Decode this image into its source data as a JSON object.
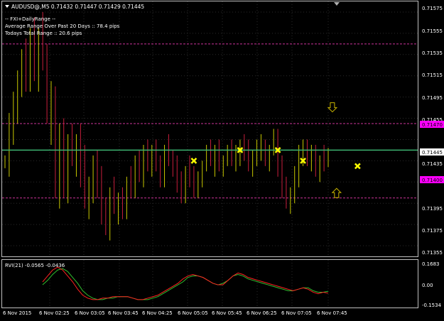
{
  "colors": {
    "background": "#000000",
    "frame": "#c0c0c0",
    "text": "#ffffff",
    "grid": "#2a2a2a",
    "bull_candle": "#c8c800",
    "bear_candle": "#c81e3c",
    "bid_line": "#3cb371",
    "range_line": "#cc3399",
    "range_tag": "#ff00ff",
    "marker": "#ffff00",
    "arrow": "#c8b400",
    "rvi_main": "#ff2020",
    "rvi_signal": "#2fbf2f"
  },
  "chart": {
    "title": "AUDUSD@,M5  0.71432 0.71447 0.71429 0.71445",
    "dropdown_icon": "chevron-down-icon",
    "info_lines": [
      "-- FXI+DailyRange --",
      "Average Range Over Past 20 Days :: 78.4 pips",
      "Todays Total Range :: 20.6 pips"
    ],
    "price_labels": [
      "0.71575",
      "0.71555",
      "0.71535",
      "0.71515",
      "0.71495",
      "0.71455",
      "0.71435",
      "0.71395",
      "0.71375",
      "0.71355"
    ],
    "current_price_tag": "0.71445",
    "upper_range_tag": "0.71470",
    "lower_range_tag": "0.71400",
    "up_arrow_icon": "up-arrow-icon",
    "down_arrow_icon": "down-arrow-icon",
    "marker_icon": "x-marker-icon"
  },
  "indicator": {
    "label": "RVI(21) -0.0565 -0.0436",
    "scale_labels": [
      "0.1683",
      "0.00",
      "-0.1534"
    ]
  },
  "time_axis": {
    "labels": [
      "6 Nov 2015",
      "6 Nov 02:25",
      "6 Nov 03:05",
      "6 Nov 03:45",
      "6 Nov 04:25",
      "6 Nov 05:05",
      "6 Nov 05:45",
      "6 Nov 06:25",
      "6 Nov 07:05",
      "6 Nov 07:45"
    ]
  },
  "chart_data": {
    "type": "candlestick",
    "instrument": "AUDUSD@",
    "timeframe": "M5",
    "last_bar": {
      "open": 0.71432,
      "high": 0.71447,
      "low": 0.71429,
      "close": 0.71445
    },
    "ylim": [
      0.71345,
      0.71585
    ],
    "daily_range": {
      "upper": 0.7147,
      "lower": 0.714,
      "upper_2": 0.71545
    },
    "x_labels": [
      "6 Nov 2015",
      "6 Nov 02:25",
      "6 Nov 03:05",
      "6 Nov 03:45",
      "6 Nov 04:25",
      "6 Nov 05:05",
      "6 Nov 05:45",
      "6 Nov 06:25",
      "6 Nov 07:05",
      "6 Nov 07:45"
    ],
    "candles": [
      [
        0.71432,
        0.7144,
        0.71428,
        0.71436
      ],
      [
        0.71436,
        0.7148,
        0.7142,
        0.7147
      ],
      [
        0.7147,
        0.715,
        0.7145,
        0.7149
      ],
      [
        0.7149,
        0.7152,
        0.7147,
        0.7151
      ],
      [
        0.7151,
        0.7154,
        0.71495,
        0.7153
      ],
      [
        0.7153,
        0.7155,
        0.715,
        0.71515
      ],
      [
        0.71515,
        0.7156,
        0.715,
        0.7154
      ],
      [
        0.7154,
        0.7157,
        0.7151,
        0.7152
      ],
      [
        0.7152,
        0.7156,
        0.715,
        0.7155
      ],
      [
        0.7155,
        0.71575,
        0.7152,
        0.7153
      ],
      [
        0.7153,
        0.71545,
        0.7147,
        0.7148
      ],
      [
        0.7148,
        0.7151,
        0.7145,
        0.715
      ],
      [
        0.715,
        0.71505,
        0.714,
        0.7142
      ],
      [
        0.7142,
        0.7147,
        0.7139,
        0.7146
      ],
      [
        0.7146,
        0.71475,
        0.714,
        0.7141
      ],
      [
        0.7141,
        0.7146,
        0.71395,
        0.71455
      ],
      [
        0.71455,
        0.7147,
        0.7143,
        0.7144
      ],
      [
        0.7144,
        0.7146,
        0.7142,
        0.7145
      ],
      [
        0.7145,
        0.7147,
        0.7141,
        0.7142
      ],
      [
        0.7142,
        0.7145,
        0.7139,
        0.714
      ],
      [
        0.714,
        0.7142,
        0.7138,
        0.7141
      ],
      [
        0.7141,
        0.7144,
        0.71395,
        0.7143
      ],
      [
        0.7143,
        0.71445,
        0.714,
        0.71405
      ],
      [
        0.71405,
        0.7143,
        0.71375,
        0.71385
      ],
      [
        0.71385,
        0.714,
        0.71365,
        0.7137
      ],
      [
        0.7137,
        0.7141,
        0.7136,
        0.714
      ],
      [
        0.714,
        0.7142,
        0.71385,
        0.7139
      ],
      [
        0.7139,
        0.71405,
        0.71375,
        0.71395
      ],
      [
        0.71395,
        0.7141,
        0.7138,
        0.71385
      ],
      [
        0.71385,
        0.7142,
        0.7138,
        0.71415
      ],
      [
        0.71415,
        0.7143,
        0.714,
        0.71405
      ],
      [
        0.71405,
        0.7144,
        0.714,
        0.7143
      ],
      [
        0.7143,
        0.71445,
        0.71415,
        0.7142
      ],
      [
        0.7142,
        0.7145,
        0.7141,
        0.71445
      ],
      [
        0.71445,
        0.71455,
        0.71425,
        0.7143
      ],
      [
        0.7143,
        0.7145,
        0.7142,
        0.7144
      ],
      [
        0.7144,
        0.71455,
        0.71425,
        0.7143
      ],
      [
        0.7143,
        0.7144,
        0.7141,
        0.7142
      ],
      [
        0.7142,
        0.7145,
        0.7141,
        0.71445
      ],
      [
        0.71445,
        0.7146,
        0.7143,
        0.71435
      ],
      [
        0.71435,
        0.71445,
        0.7142,
        0.71425
      ],
      [
        0.71425,
        0.7144,
        0.71405,
        0.7141
      ],
      [
        0.7141,
        0.71425,
        0.71395,
        0.714
      ],
      [
        0.714,
        0.7143,
        0.71395,
        0.71425
      ],
      [
        0.71425,
        0.7144,
        0.7141,
        0.71415
      ],
      [
        0.71415,
        0.7143,
        0.714,
        0.71405
      ],
      [
        0.71405,
        0.71425,
        0.714,
        0.7142
      ],
      [
        0.7142,
        0.71435,
        0.7141,
        0.7143
      ],
      [
        0.7143,
        0.7145,
        0.71425,
        0.71445
      ],
      [
        0.71445,
        0.71455,
        0.7143,
        0.71435
      ],
      [
        0.71435,
        0.7145,
        0.7142,
        0.7144
      ],
      [
        0.7144,
        0.71455,
        0.71425,
        0.7143
      ],
      [
        0.7143,
        0.7144,
        0.7142,
        0.71435
      ],
      [
        0.71435,
        0.7145,
        0.7143,
        0.71445
      ],
      [
        0.71445,
        0.71455,
        0.7143,
        0.71435
      ],
      [
        0.71435,
        0.7145,
        0.71425,
        0.7144
      ],
      [
        0.7144,
        0.71455,
        0.7143,
        0.7145
      ],
      [
        0.7145,
        0.7146,
        0.71435,
        0.7144
      ],
      [
        0.7144,
        0.71455,
        0.71425,
        0.7143
      ],
      [
        0.7143,
        0.71445,
        0.7142,
        0.7144
      ],
      [
        0.7144,
        0.71455,
        0.7143,
        0.71445
      ],
      [
        0.71445,
        0.7146,
        0.71435,
        0.7145
      ],
      [
        0.7145,
        0.71455,
        0.7143,
        0.71435
      ],
      [
        0.71435,
        0.7145,
        0.71425,
        0.71445
      ],
      [
        0.71445,
        0.71465,
        0.7144,
        0.7146
      ],
      [
        0.7146,
        0.71465,
        0.7142,
        0.71425
      ],
      [
        0.71425,
        0.7144,
        0.714,
        0.71405
      ],
      [
        0.71405,
        0.7142,
        0.7139,
        0.71395
      ],
      [
        0.71395,
        0.7141,
        0.71385,
        0.714
      ],
      [
        0.714,
        0.7143,
        0.71395,
        0.71425
      ],
      [
        0.71425,
        0.7145,
        0.7141,
        0.7144
      ],
      [
        0.7144,
        0.71455,
        0.7143,
        0.7145
      ],
      [
        0.7145,
        0.71455,
        0.7143,
        0.71435
      ],
      [
        0.71435,
        0.7145,
        0.71425,
        0.7144
      ],
      [
        0.7144,
        0.7145,
        0.7142,
        0.71425
      ],
      [
        0.71425,
        0.7144,
        0.71415,
        0.71435
      ],
      [
        0.71435,
        0.7145,
        0.71425,
        0.7143
      ],
      [
        0.71432,
        0.71447,
        0.71429,
        0.71445
      ]
    ],
    "markers": [
      {
        "bar": 45,
        "price": 0.71435
      },
      {
        "bar": 56,
        "price": 0.71445
      },
      {
        "bar": 65,
        "price": 0.71445
      },
      {
        "bar": 71,
        "price": 0.71435
      },
      {
        "bar": 84,
        "price": 0.7143
      }
    ],
    "arrows": [
      {
        "direction": "down",
        "bar": 78,
        "price": 0.71485
      },
      {
        "direction": "up",
        "bar": 79,
        "price": 0.71405
      }
    ],
    "rvi": {
      "ylim": [
        -0.1534,
        0.1683
      ],
      "main": [
        0.02,
        0.06,
        0.1,
        0.12,
        0.1,
        0.06,
        0.02,
        -0.03,
        -0.07,
        -0.09,
        -0.1,
        -0.1,
        -0.09,
        -0.09,
        -0.08,
        -0.08,
        -0.08,
        -0.08,
        -0.09,
        -0.1,
        -0.1,
        -0.09,
        -0.08,
        -0.07,
        -0.05,
        -0.03,
        -0.01,
        0.01,
        0.04,
        0.06,
        0.07,
        0.06,
        0.05,
        0.03,
        0.01,
        0.0,
        0.0,
        0.03,
        0.06,
        0.08,
        0.07,
        0.05,
        0.04,
        0.03,
        0.02,
        0.01,
        0.0,
        -0.01,
        -0.02,
        -0.03,
        -0.04,
        -0.03,
        -0.02,
        -0.03,
        -0.05,
        -0.06,
        -0.05,
        -0.0565
      ],
      "signal": [
        0.0,
        0.03,
        0.07,
        0.1,
        0.11,
        0.09,
        0.05,
        0.01,
        -0.04,
        -0.07,
        -0.09,
        -0.1,
        -0.1,
        -0.09,
        -0.09,
        -0.08,
        -0.08,
        -0.08,
        -0.09,
        -0.1,
        -0.1,
        -0.1,
        -0.09,
        -0.08,
        -0.06,
        -0.04,
        -0.02,
        0.0,
        0.02,
        0.05,
        0.06,
        0.06,
        0.05,
        0.03,
        0.01,
        0.0,
        0.01,
        0.03,
        0.06,
        0.07,
        0.06,
        0.04,
        0.03,
        0.02,
        0.01,
        0.0,
        -0.01,
        -0.02,
        -0.03,
        -0.04,
        -0.04,
        -0.03,
        -0.02,
        -0.02,
        -0.04,
        -0.05,
        -0.05,
        -0.0436
      ]
    }
  }
}
